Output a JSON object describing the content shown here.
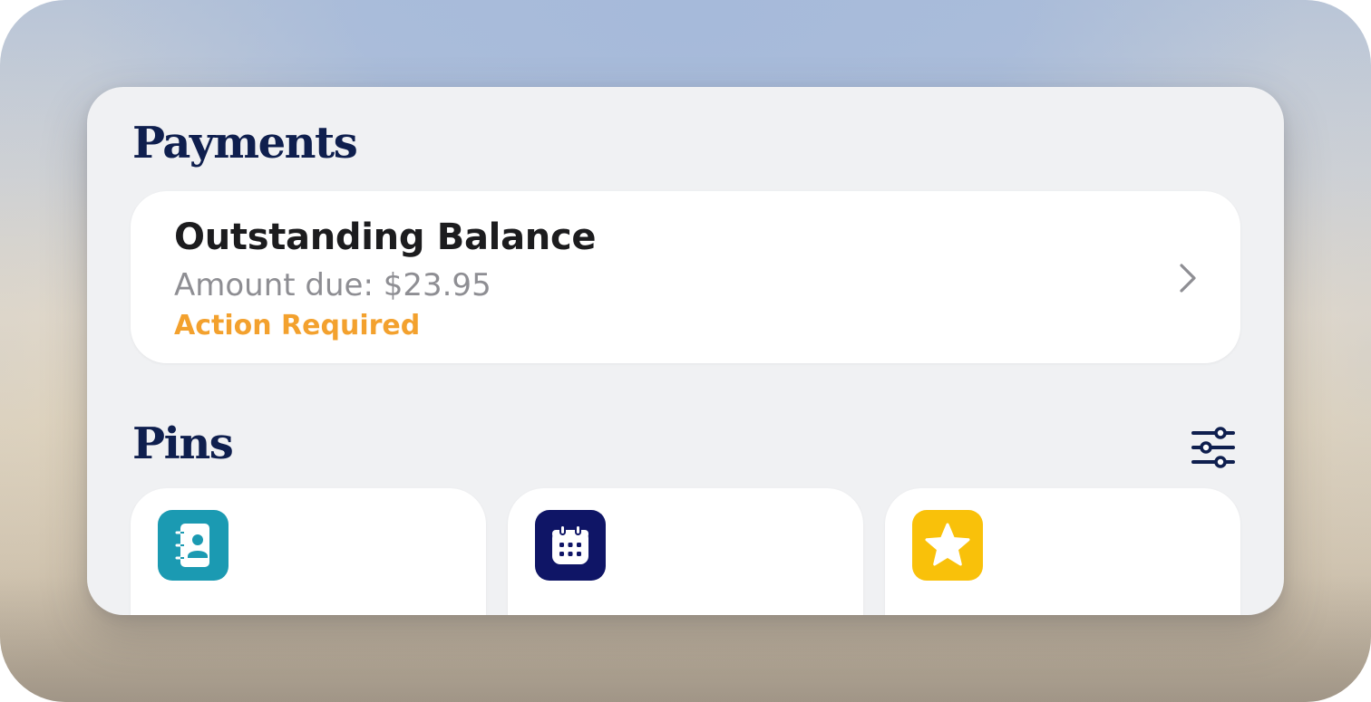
{
  "payments": {
    "title": "Payments",
    "balance": {
      "title": "Outstanding Balance",
      "amount": "Amount due: $23.95",
      "status": "Action Required",
      "status_color": "#f3a12e"
    }
  },
  "pins": {
    "title": "Pins",
    "filter_icon": "sliders-icon",
    "items": [
      {
        "icon": "contacts-book-icon",
        "color": "#1b9ab2"
      },
      {
        "icon": "calendar-icon",
        "color": "#0f1566"
      },
      {
        "icon": "star-icon",
        "color": "#f9c10a"
      }
    ]
  },
  "colors": {
    "heading": "#0f1f4e",
    "card_background": "#f0f1f3"
  }
}
